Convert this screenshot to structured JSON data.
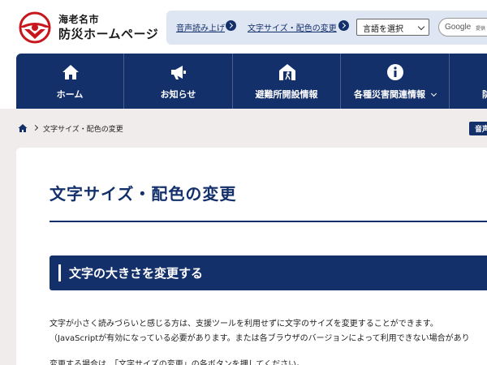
{
  "header": {
    "city": "海老名市",
    "site_name": "防災ホームページ"
  },
  "utility": {
    "read_aloud": "音声読み上げ",
    "font_color": "文字サイズ・配色の変更",
    "language_select": "言語を選択",
    "search_brand": "Google",
    "search_suffix": "提供"
  },
  "nav": {
    "items": [
      {
        "label": "ホーム",
        "icon": "home-icon"
      },
      {
        "label": "お知らせ",
        "icon": "megaphone-icon"
      },
      {
        "label": "避難所開設情報",
        "icon": "shelter-icon"
      },
      {
        "label": "各種災害関連情報",
        "icon": "info-icon"
      },
      {
        "label": "防",
        "icon": "partial-icon"
      }
    ]
  },
  "breadcrumb": {
    "current": "文字サイズ・配色の変更"
  },
  "read_button": "音声",
  "main": {
    "title": "文字サイズ・配色の変更",
    "section_heading": "文字の大きさを変更する",
    "paragraph_1": "文字が小さく読みづらいと感じる方は、支援ツールを利用せずに文字のサイズを変更することができます。",
    "paragraph_2": "（JavaScriptが有効になっている必要があります。または各ブラウザのバージョンによって利用できない場合があり",
    "paragraph_3": "変更する場合は、「文字サイズの変更」の各ボタンを押してください。"
  },
  "colors": {
    "navy": "#14306b",
    "utility_bg": "#dfe6f3",
    "gray_bg": "#efeceb",
    "logo_red": "#c8161d"
  }
}
